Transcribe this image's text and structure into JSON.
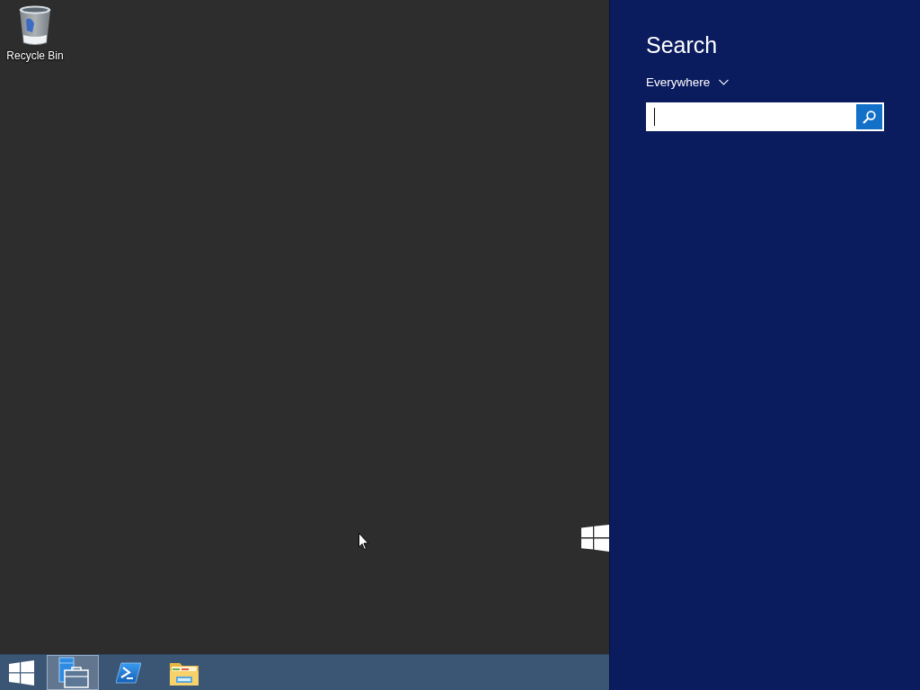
{
  "desktop": {
    "icons": [
      {
        "kind": "recycle-bin",
        "label": "Recycle Bin"
      }
    ]
  },
  "taskbar": {
    "buttons": [
      {
        "kind": "start",
        "selected": false
      },
      {
        "kind": "server-manager",
        "selected": true
      },
      {
        "kind": "powershell",
        "selected": false
      },
      {
        "kind": "file-explorer",
        "selected": false
      }
    ]
  },
  "search_pane": {
    "title": "Search",
    "scope": "Everywhere",
    "search": {
      "focused": true
    }
  }
}
